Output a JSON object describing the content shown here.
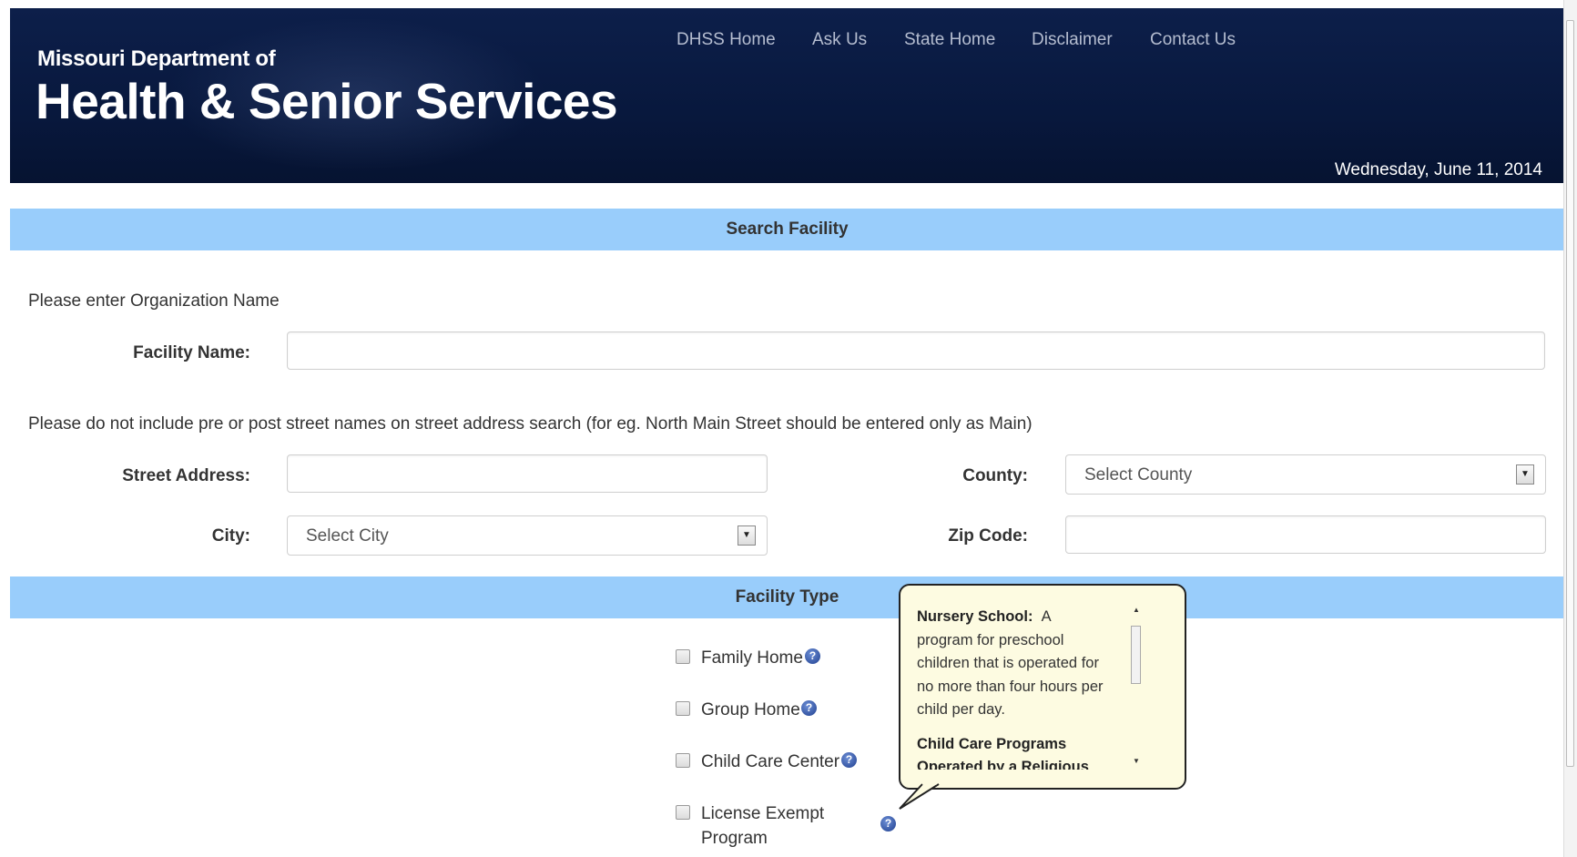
{
  "header": {
    "dept_line": "Missouri Department of",
    "title": "Health & Senior Services",
    "date": "Wednesday, June 11, 2014",
    "nav": [
      "DHSS Home",
      "Ask Us",
      "State Home",
      "Disclaimer",
      "Contact Us"
    ]
  },
  "search_section": {
    "title": "Search Facility",
    "org_hint": "Please enter Organization Name",
    "facility_name_label": "Facility Name:",
    "facility_name_value": "",
    "street_hint": "Please do not include pre or post street names on street address search (for eg. North Main Street should be entered only as Main)",
    "street_label": "Street Address:",
    "street_value": "",
    "county_label": "County:",
    "county_selected": "Select County",
    "city_label": "City:",
    "city_selected": "Select City",
    "zip_label": "Zip Code:",
    "zip_value": ""
  },
  "facility_type": {
    "title": "Facility Type",
    "options": [
      "Family Home",
      "Group Home",
      "Child Care Center",
      "License Exempt",
      "Program"
    ]
  },
  "tooltip": {
    "term1": "Nursery School:",
    "text1a": "A",
    "text1b": "program for preschool",
    "text1c": "children that is operated for",
    "text1d": "no more than four hours per",
    "text1e": "child per day.",
    "term2a": "Child Care Programs",
    "term2b": "Operated by a Religious"
  },
  "icons": {
    "help": "help-question-icon",
    "dropdown": "dropdown-arrow-icon",
    "checkbox": "checkbox-icon"
  },
  "colors": {
    "header_bg": "#08183d",
    "section_bar": "#99cdfb",
    "tooltip_bg": "#fdfbe1"
  }
}
